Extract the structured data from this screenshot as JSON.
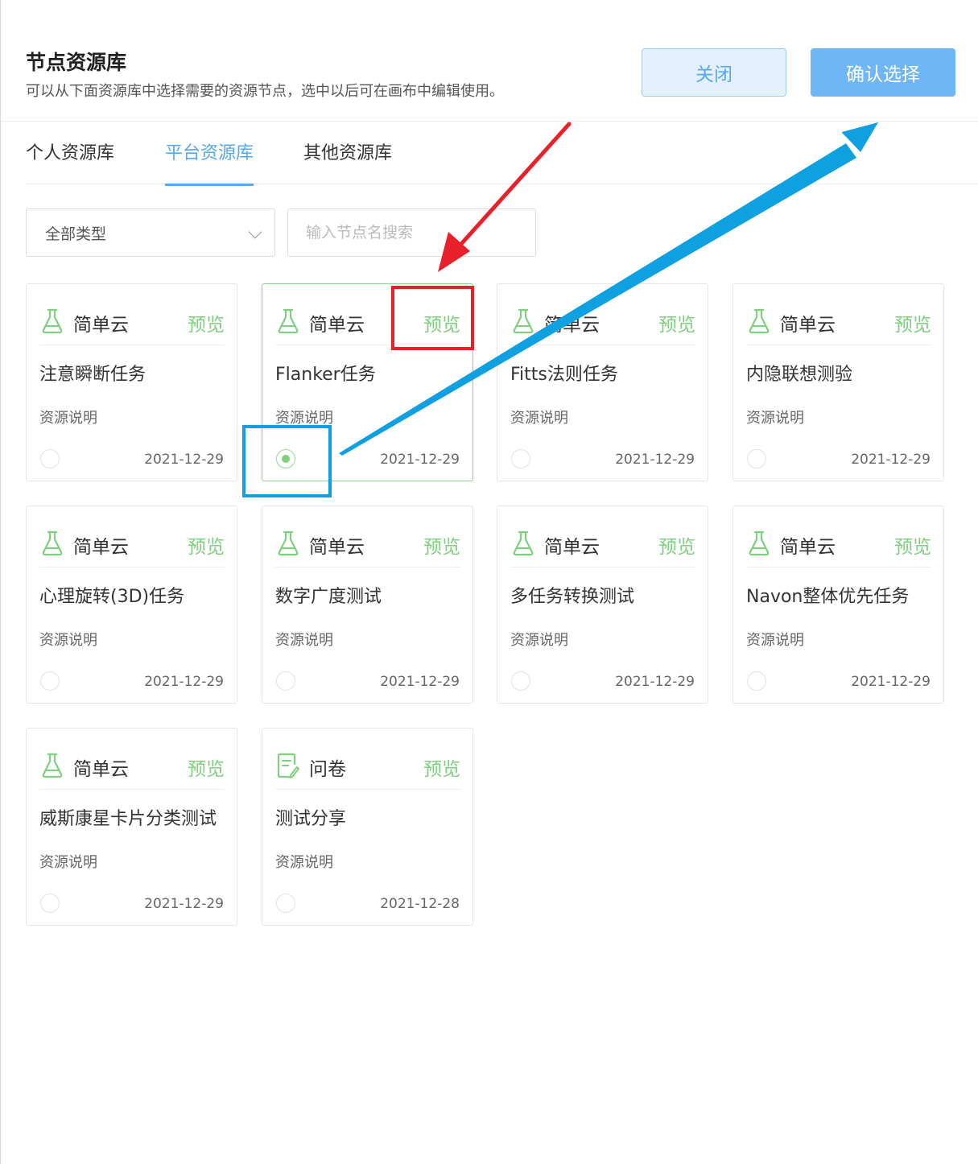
{
  "header": {
    "title": "节点资源库",
    "subtitle": "可以从下面资源库中选择需要的资源节点，选中以后可在画布中编辑使用。",
    "close_label": "关闭",
    "confirm_label": "确认选择"
  },
  "tabs": [
    {
      "label": "个人资源库",
      "active": false
    },
    {
      "label": "平台资源库",
      "active": true
    },
    {
      "label": "其他资源库",
      "active": false
    }
  ],
  "filter": {
    "type_select_value": "全部类型",
    "search_placeholder": "输入节点名搜索",
    "search_value": ""
  },
  "cards": [
    {
      "type": "简单云",
      "icon": "flask-icon",
      "preview": "预览",
      "name": "注意瞬断任务",
      "desc": "资源说明",
      "date": "2021-12-29",
      "selected": false
    },
    {
      "type": "简单云",
      "icon": "flask-icon",
      "preview": "预览",
      "name": "Flanker任务",
      "desc": "资源说明",
      "date": "2021-12-29",
      "selected": true
    },
    {
      "type": "简单云",
      "icon": "flask-icon",
      "preview": "预览",
      "name": "Fitts法则任务",
      "desc": "资源说明",
      "date": "2021-12-29",
      "selected": false
    },
    {
      "type": "简单云",
      "icon": "flask-icon",
      "preview": "预览",
      "name": "内隐联想测验",
      "desc": "资源说明",
      "date": "2021-12-29",
      "selected": false
    },
    {
      "type": "简单云",
      "icon": "flask-icon",
      "preview": "预览",
      "name": "心理旋转(3D)任务",
      "desc": "资源说明",
      "date": "2021-12-29",
      "selected": false
    },
    {
      "type": "简单云",
      "icon": "flask-icon",
      "preview": "预览",
      "name": "数字广度测试",
      "desc": "资源说明",
      "date": "2021-12-29",
      "selected": false
    },
    {
      "type": "简单云",
      "icon": "flask-icon",
      "preview": "预览",
      "name": "多任务转换测试",
      "desc": "资源说明",
      "date": "2021-12-29",
      "selected": false
    },
    {
      "type": "简单云",
      "icon": "flask-icon",
      "preview": "预览",
      "name": "Navon整体优先任务",
      "desc": "资源说明",
      "date": "2021-12-29",
      "selected": false
    },
    {
      "type": "简单云",
      "icon": "flask-icon",
      "preview": "预览",
      "name": "威斯康星卡片分类测试",
      "desc": "资源说明",
      "date": "2021-12-29",
      "selected": false
    },
    {
      "type": "问卷",
      "icon": "questionnaire-icon",
      "preview": "预览",
      "name": "测试分享",
      "desc": "资源说明",
      "date": "2021-12-28",
      "selected": false
    }
  ],
  "colors": {
    "accent_blue": "#56a8ef",
    "preview_green": "#7fcf7f",
    "annotation_red": "#e8202a",
    "annotation_blue": "#0ea0e0"
  }
}
